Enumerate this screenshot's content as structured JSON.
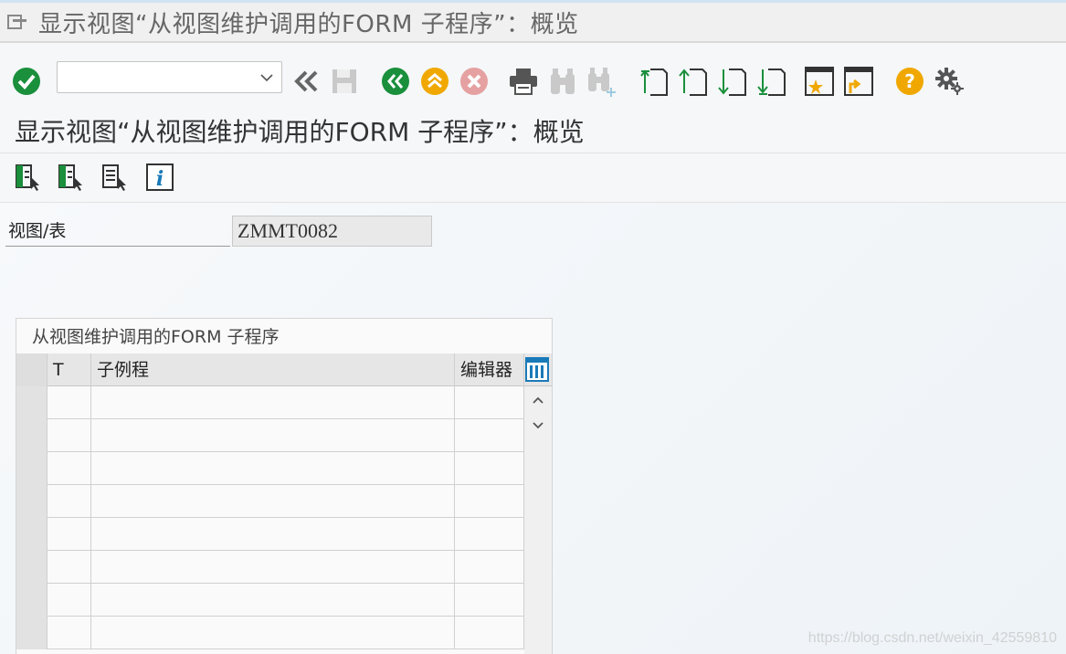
{
  "window": {
    "title": "显示视图“从视图维护调用的FORM 子程序”：概览"
  },
  "toolbar": {
    "command_field_value": "",
    "icons": [
      "enter-icon",
      "command-dropdown-icon",
      "back-double-icon",
      "save-icon",
      "back-icon",
      "exit-icon",
      "cancel-icon",
      "print-icon",
      "find-icon",
      "find-next-icon",
      "first-page-icon",
      "previous-page-icon",
      "next-page-icon",
      "last-page-icon",
      "create-session-icon",
      "shortcut-icon",
      "help-icon",
      "settings-icon"
    ],
    "colors": {
      "green": "#1a8f3c",
      "orange": "#f0a800",
      "red": "#e5a1a1",
      "gray": "#b8b8b8"
    }
  },
  "page": {
    "title": "显示视图“从视图维护调用的FORM 子程序”：概览",
    "app_toolbar_icons": [
      "detail-icon",
      "select-all-icon",
      "deselect-icon",
      "info-icon"
    ]
  },
  "form": {
    "view_table_label": "视图/表",
    "view_table_value": "ZMMT0082"
  },
  "table": {
    "caption": "从视图维护调用的FORM 子程序",
    "columns": [
      "T",
      "子例程",
      "编辑器"
    ],
    "rows": [
      [
        "",
        "",
        ""
      ],
      [
        "",
        "",
        ""
      ],
      [
        "",
        "",
        ""
      ],
      [
        "",
        "",
        ""
      ],
      [
        "",
        "",
        ""
      ],
      [
        "",
        "",
        ""
      ],
      [
        "",
        "",
        ""
      ],
      [
        "",
        "",
        ""
      ]
    ]
  },
  "watermark": "https://blog.csdn.net/weixin_42559810"
}
